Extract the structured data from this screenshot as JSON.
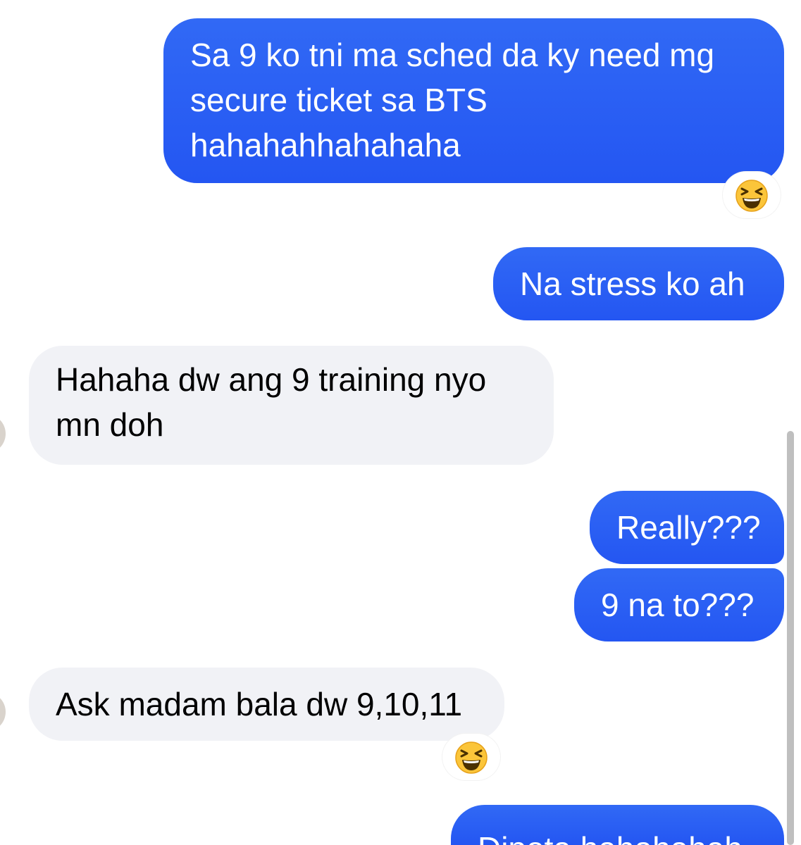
{
  "messages": [
    {
      "id": 1,
      "direction": "outgoing",
      "lines": [
        "Sa 9 ko tni ma sched da ky need mg",
        "secure ticket sa BTS",
        "hahahahhahahaha"
      ],
      "reaction": "laughing-squinting-face"
    },
    {
      "id": 2,
      "direction": "outgoing",
      "lines": [
        "Na stress ko ah"
      ]
    },
    {
      "id": 3,
      "direction": "incoming",
      "lines": [
        "Hahaha dw ang 9 training nyo",
        "mn doh"
      ]
    },
    {
      "id": 4,
      "direction": "outgoing",
      "lines": [
        "Really???"
      ]
    },
    {
      "id": 5,
      "direction": "outgoing",
      "lines": [
        "9 na to???"
      ]
    },
    {
      "id": 6,
      "direction": "incoming",
      "lines": [
        "Ask madam bala dw 9,10,11"
      ],
      "reaction": "laughing-squinting-face"
    },
    {
      "id": 7,
      "direction": "outgoing",
      "lines": [
        "Dipota hahahahah"
      ]
    }
  ],
  "colors": {
    "outgoing_bubble": "#2c62f4",
    "incoming_bubble": "#f1f2f6",
    "outgoing_text": "#ffffff",
    "incoming_text": "#000000"
  }
}
